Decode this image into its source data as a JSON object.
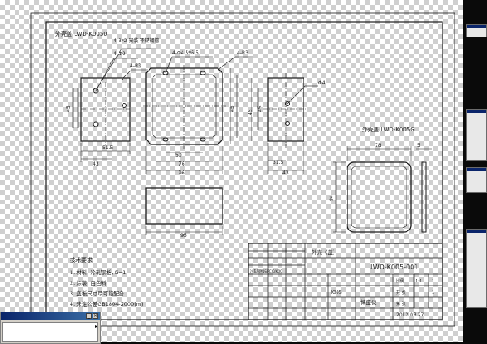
{
  "drawing": {
    "top_left_label": "外壳盖 LWD-K005U",
    "callouts": {
      "c1": "4-3*2 安装 不锈钢管",
      "c2": "4-Φ9",
      "c3": "4-R3",
      "c4": "4-Φ4.5*6.5",
      "c5": "4-R3",
      "c6": "Φ4"
    },
    "dims": {
      "d45v": "45",
      "d51": "51.5",
      "d43": "43",
      "d50": "50",
      "d76": "76",
      "d96": "96",
      "d45r": "45",
      "d45r2": "45",
      "d455": "45",
      "d315": "31.5",
      "d43r": "43",
      "d96b": "96",
      "d78": "78",
      "d5": "5",
      "d94": "94"
    },
    "right_label": "外壳盖 LWD-K005G",
    "notes": {
      "title": "技术要求",
      "items": [
        "1. 材料: 冷轧钢板, δ=1",
        "2. 涂装: 白色料",
        "3. 盖板尺寸尽可能配合",
        "4. 未注公差GB1804-2000(m)"
      ]
    },
    "title_block": {
      "part_name": "外壳（盖）",
      "drawing_no": "LWD-K005-001",
      "material": "冷轧钢板SPCC/K00",
      "company_short": "博盛仪",
      "date": "2012.03.27",
      "scale_label": "比例",
      "scale_value": "1:1",
      "sheet_label": "共 张",
      "sheet_value": "1",
      "weight_value": "1",
      "sub_code": "K005",
      "unit_label": "第 张"
    }
  },
  "ui": {
    "panel_close": "×",
    "panel_min": "_",
    "panel_arrow": "▸"
  },
  "colors": {
    "ink": "#1a1a1a",
    "checker": "#cfcfcf",
    "titlebar": "#0a246a"
  }
}
